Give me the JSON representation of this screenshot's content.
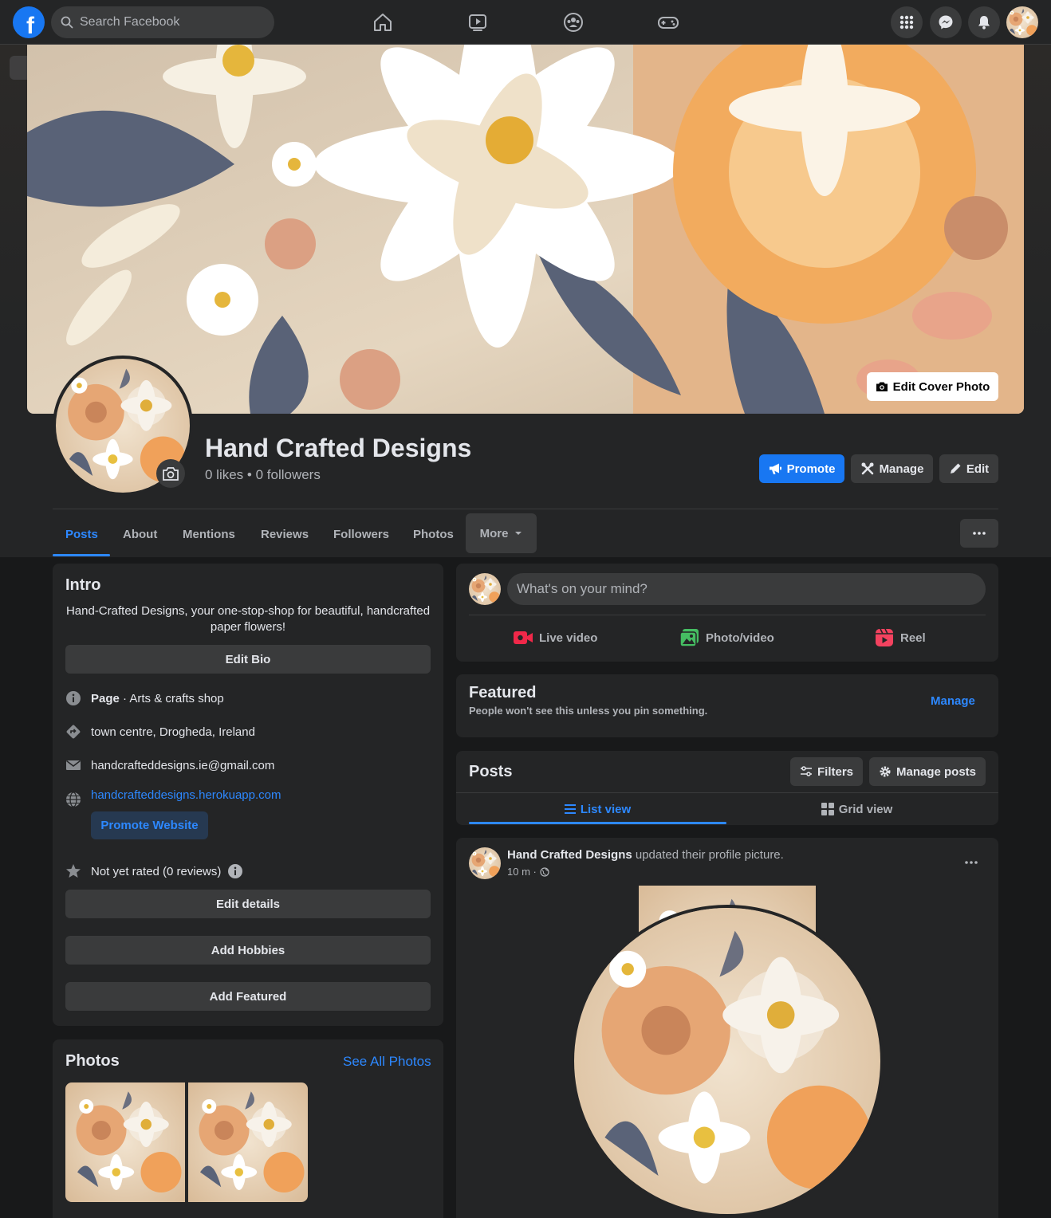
{
  "topbar": {
    "logo_letter": "f",
    "search_placeholder": "Search Facebook"
  },
  "page": {
    "name": "Hand Crafted Designs",
    "stats": "0 likes • 0 followers",
    "edit_cover_label": "Edit Cover Photo",
    "promote_label": "Promote",
    "manage_label": "Manage",
    "edit_label": "Edit"
  },
  "tabs": [
    {
      "label": "Posts",
      "active": true
    },
    {
      "label": "About"
    },
    {
      "label": "Mentions"
    },
    {
      "label": "Reviews"
    },
    {
      "label": "Followers"
    },
    {
      "label": "Photos"
    },
    {
      "label": "More"
    }
  ],
  "intro": {
    "title": "Intro",
    "bio": "Hand-Crafted Designs, your one-stop-shop for beautiful, handcrafted paper flowers!",
    "edit_bio_label": "Edit Bio",
    "category_bold": "Page",
    "category_rest": " · Arts & crafts shop",
    "location": "town centre, Drogheda, Ireland",
    "email": "handcrafteddesigns.ie@gmail.com",
    "website": "handcrafteddesigns.herokuapp.com",
    "promote_website_label": "Promote Website",
    "rating": "Not yet rated (0 reviews)",
    "edit_details_label": "Edit details",
    "add_hobbies_label": "Add Hobbies",
    "add_featured_label": "Add Featured"
  },
  "photos": {
    "title": "Photos",
    "see_all_label": "See All Photos"
  },
  "composer": {
    "placeholder": "What's on your mind?",
    "live_label": "Live video",
    "photo_label": "Photo/video",
    "reel_label": "Reel"
  },
  "featured": {
    "title": "Featured",
    "subtitle": "People won't see this unless you pin something.",
    "manage_label": "Manage"
  },
  "posts": {
    "title": "Posts",
    "filters_label": "Filters",
    "manage_posts_label": "Manage posts",
    "list_view_label": "List view",
    "grid_view_label": "Grid view"
  },
  "post": {
    "author": "Hand Crafted Designs",
    "action": " updated their profile picture.",
    "time": "10 m ·"
  },
  "colors": {
    "accent": "#2d88ff",
    "brand": "#1877f2",
    "card": "#242526",
    "background": "#18191a"
  }
}
